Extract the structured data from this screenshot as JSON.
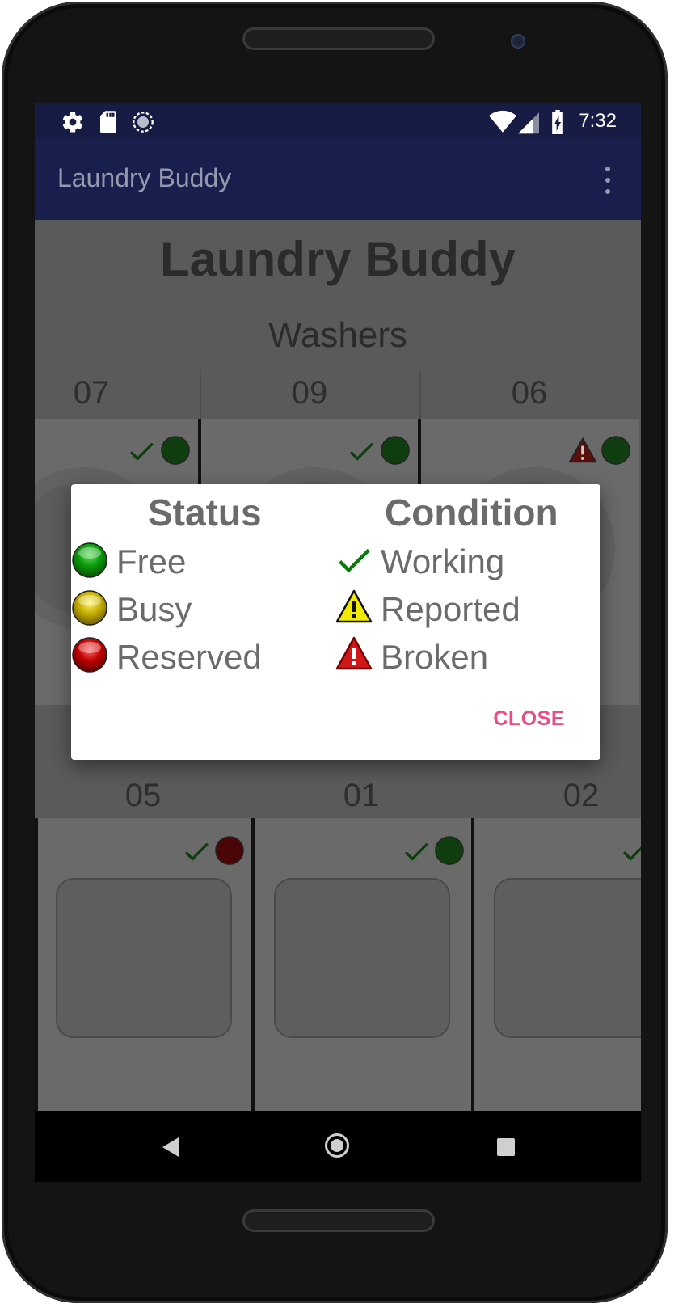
{
  "statusbar": {
    "time": "7:32",
    "icons": [
      "settings-icon",
      "sd-card-icon",
      "sync-icon",
      "wifi-icon",
      "signal-icon",
      "battery-charging-icon"
    ]
  },
  "appbar": {
    "title": "Laundry Buddy",
    "menu_icon": "more-vert-icon"
  },
  "page": {
    "title": "Laundry Buddy",
    "section": "Washers"
  },
  "washers": [
    {
      "label": "07",
      "condition": "working",
      "status": "free"
    },
    {
      "label": "09",
      "condition": "working",
      "status": "free"
    },
    {
      "label": "06",
      "condition": "broken",
      "status": "free"
    }
  ],
  "dryers": [
    {
      "label": "05",
      "condition": "working",
      "status": "reserved"
    },
    {
      "label": "01",
      "condition": "working",
      "status": "free"
    },
    {
      "label": "02",
      "condition": "working",
      "status": ""
    }
  ],
  "dialog": {
    "status_heading": "Status",
    "condition_heading": "Condition",
    "status_items": [
      {
        "label": "Free",
        "color": "#0a8a0a"
      },
      {
        "label": "Busy",
        "color": "#b8a400"
      },
      {
        "label": "Reserved",
        "color": "#b00000"
      }
    ],
    "condition_items": [
      {
        "label": "Working",
        "icon": "check-icon",
        "color": "#0a7a0a"
      },
      {
        "label": "Reported",
        "icon": "warning-yellow-icon",
        "color": "#f2ea00"
      },
      {
        "label": "Broken",
        "icon": "warning-red-icon",
        "color": "#d01818"
      }
    ],
    "close_label": "CLOSE"
  },
  "colors": {
    "statusbar": "#171c45",
    "appbar": "#181f4d",
    "accent": "#ea4b86"
  }
}
